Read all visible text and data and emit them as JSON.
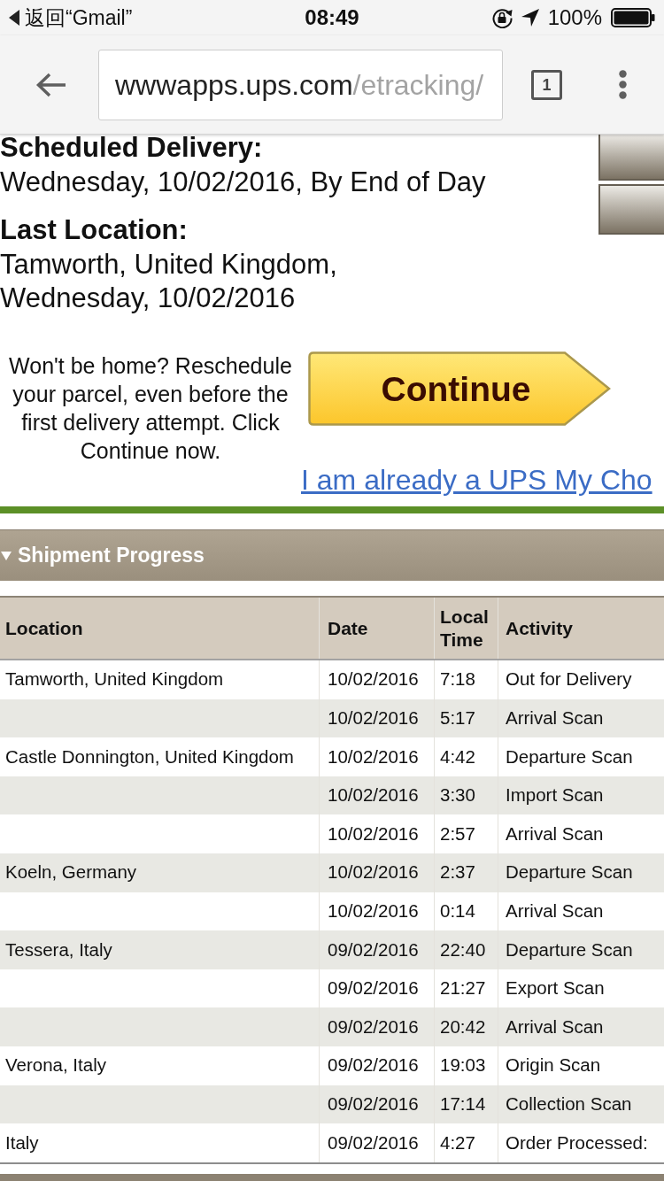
{
  "status_bar": {
    "back_label": "返回“Gmail”",
    "time": "08:49",
    "battery_text": "100%"
  },
  "browser": {
    "url_host": "wwwapps.ups.com",
    "url_path": "/etracking/",
    "tab_count": "1"
  },
  "delivery": {
    "scheduled_label": "Scheduled Delivery:",
    "scheduled_value": "Wednesday, 10/02/2016, By End of Day",
    "location_label": "Last Location:",
    "location_lines": [
      "Tamworth, United Kingdom,",
      "Wednesday, 10/02/2016"
    ]
  },
  "reschedule": {
    "message": "Won't be home? Reschedule your parcel, even before the first delivery attempt. Click Continue now.",
    "button": "Continue",
    "link": "I am already a UPS My Cho"
  },
  "shipment_progress": {
    "title": "Shipment Progress",
    "expanded": true,
    "columns": [
      "Location",
      "Date",
      "Local Time",
      "Activity"
    ],
    "rows": [
      {
        "location": "Tamworth, United Kingdom",
        "date": "10/02/2016",
        "local_time": "7:18",
        "activity": "Out for Delivery"
      },
      {
        "date": "10/02/2016",
        "local_time": "5:17",
        "activity": "Arrival Scan"
      },
      {
        "location": "Castle Donnington, United Kingdom",
        "date": "10/02/2016",
        "local_time": "4:42",
        "activity": "Departure Scan"
      },
      {
        "date": "10/02/2016",
        "local_time": "3:30",
        "activity": "Import Scan"
      },
      {
        "date": "10/02/2016",
        "local_time": "2:57",
        "activity": "Arrival Scan"
      },
      {
        "location": "Koeln, Germany",
        "date": "10/02/2016",
        "local_time": "2:37",
        "activity": "Departure Scan"
      },
      {
        "date": "10/02/2016",
        "local_time": "0:14",
        "activity": "Arrival Scan"
      },
      {
        "location": "Tessera, Italy",
        "date": "09/02/2016",
        "local_time": "22:40",
        "activity": "Departure Scan"
      },
      {
        "date": "09/02/2016",
        "local_time": "21:27",
        "activity": "Export Scan"
      },
      {
        "date": "09/02/2016",
        "local_time": "20:42",
        "activity": "Arrival Scan"
      },
      {
        "location": "Verona, Italy",
        "date": "09/02/2016",
        "local_time": "19:03",
        "activity": "Origin Scan"
      },
      {
        "date": "09/02/2016",
        "local_time": "17:14",
        "activity": "Collection Scan"
      },
      {
        "location": "Italy",
        "date": "09/02/2016",
        "local_time": "4:27",
        "activity": "Order Processed:"
      }
    ]
  }
}
